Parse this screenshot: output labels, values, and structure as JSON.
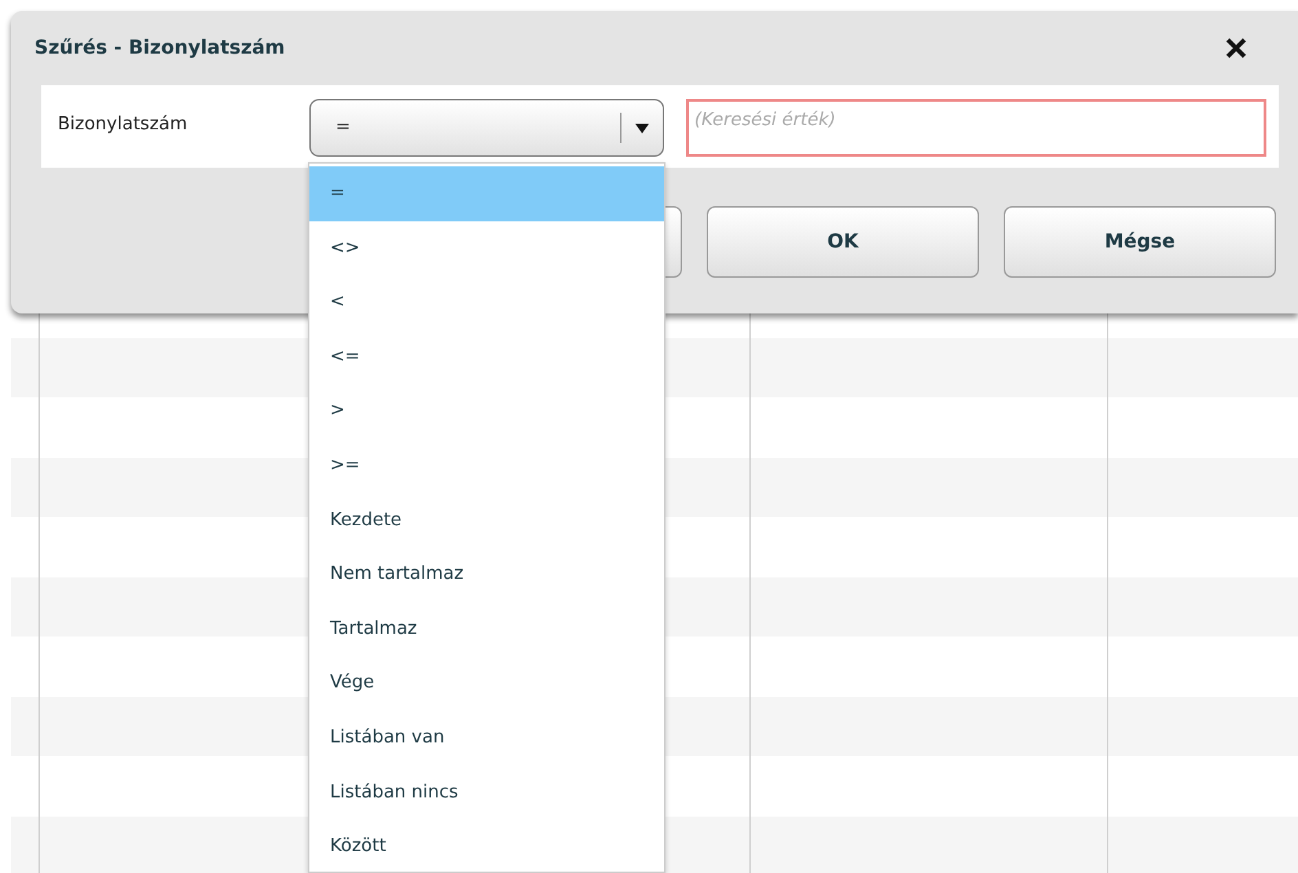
{
  "dialog": {
    "title": "Szűrés - Bizonylatszám",
    "field_label": "Bizonylatszám",
    "operator": {
      "value": "=",
      "expanded": true,
      "options": [
        {
          "label": "=",
          "selected": true
        },
        {
          "label": "<>",
          "selected": false
        },
        {
          "label": "<",
          "selected": false
        },
        {
          "label": "<=",
          "selected": false
        },
        {
          "label": ">",
          "selected": false
        },
        {
          "label": ">=",
          "selected": false
        },
        {
          "label": "Kezdete",
          "selected": false
        },
        {
          "label": "Nem tartalmaz",
          "selected": false
        },
        {
          "label": "Tartalmaz",
          "selected": false
        },
        {
          "label": "Vége",
          "selected": false
        },
        {
          "label": "Listában van",
          "selected": false
        },
        {
          "label": "Listában nincs",
          "selected": false
        },
        {
          "label": "Között",
          "selected": false
        }
      ]
    },
    "search": {
      "placeholder": "(Keresési érték)",
      "invalid": true
    },
    "buttons": [
      "OK",
      "Mégse"
    ]
  }
}
